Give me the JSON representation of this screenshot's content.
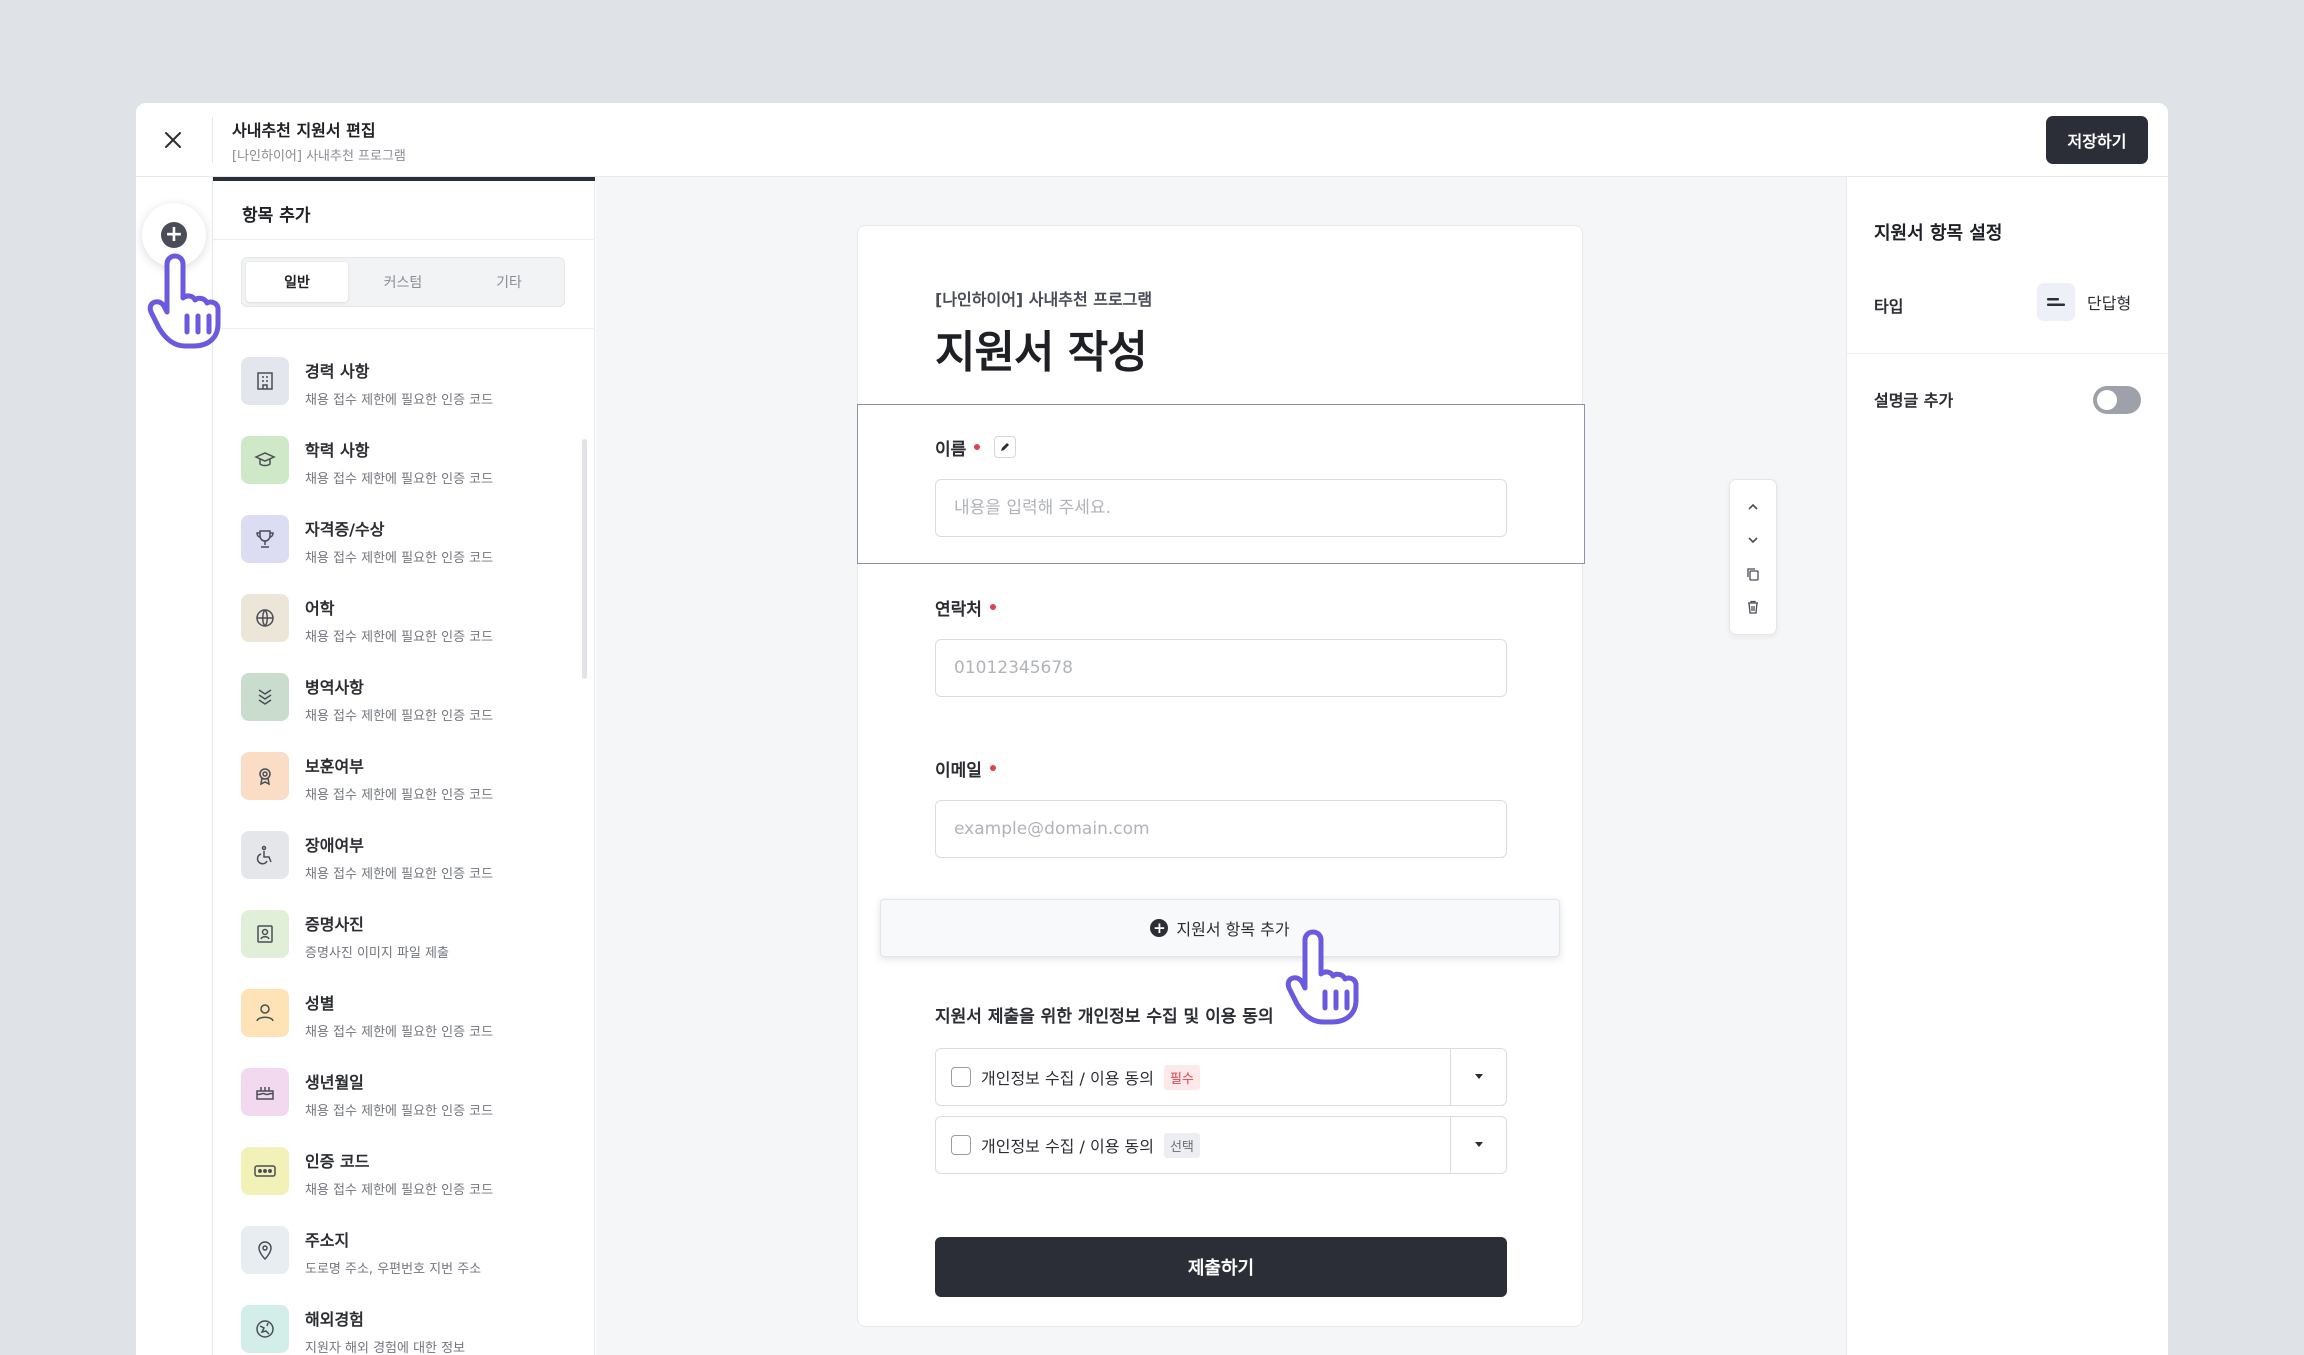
{
  "header": {
    "title": "사내추천 지원서 편집",
    "subtitle": "[나인하이어] 사내추천 프로그램",
    "save_label": "저장하기"
  },
  "panel": {
    "heading": "항목 추가",
    "tabs": [
      {
        "label": "일반",
        "active": true
      },
      {
        "label": "커스텀",
        "active": false
      },
      {
        "label": "기타",
        "active": false
      }
    ],
    "items": [
      {
        "title": "경력 사항",
        "desc": "채용 접수 제한에 필요한 인증 코드",
        "icon": "building-icon",
        "color": "#e3e6ec"
      },
      {
        "title": "학력 사항",
        "desc": "채용 접수 제한에 필요한 인증 코드",
        "icon": "graduation-cap-icon",
        "color": "#cfe9c8"
      },
      {
        "title": "자격증/수상",
        "desc": "채용 접수 제한에 필요한 인증 코드",
        "icon": "trophy-icon",
        "color": "#dcdcf3"
      },
      {
        "title": "어학",
        "desc": "채용 접수 제한에 필요한 인증 코드",
        "icon": "globe-icon",
        "color": "#ece6d8"
      },
      {
        "title": "병역사항",
        "desc": "채용 접수 제한에 필요한 인증 코드",
        "icon": "chevrons-down-icon",
        "color": "#c9dccd"
      },
      {
        "title": "보훈여부",
        "desc": "채용 접수 제한에 필요한 인증 코드",
        "icon": "medal-icon",
        "color": "#fbdcc5"
      },
      {
        "title": "장애여부",
        "desc": "채용 접수 제한에 필요한 인증 코드",
        "icon": "wheelchair-icon",
        "color": "#e4e6ea"
      },
      {
        "title": "증명사진",
        "desc": "증명사진 이미지 파일 제출",
        "icon": "id-photo-icon",
        "color": "#e1efd8"
      },
      {
        "title": "성별",
        "desc": "채용 접수 제한에 필요한 인증 코드",
        "icon": "person-icon",
        "color": "#fde3b5"
      },
      {
        "title": "생년월일",
        "desc": "채용 접수 제한에 필요한 인증 코드",
        "icon": "cake-icon",
        "color": "#f3d9ef"
      },
      {
        "title": "인증 코드",
        "desc": "채용 접수 제한에 필요한 인증 코드",
        "icon": "password-icon",
        "color": "#f1f1b8"
      },
      {
        "title": "주소지",
        "desc": "도로명 주소, 우편번호 지번 주소",
        "icon": "map-pin-icon",
        "color": "#e8edf2"
      },
      {
        "title": "해외경험",
        "desc": "지원자 해외 경험에 대한 정보",
        "icon": "globe-plane-icon",
        "color": "#d3eee8"
      }
    ]
  },
  "form": {
    "program": "[나인하이어] 사내추천 프로그램",
    "title": "지원서 작성",
    "fields": [
      {
        "label": "이름",
        "placeholder": "내용을 입력해 주세요."
      },
      {
        "label": "연락처",
        "placeholder": "01012345678"
      },
      {
        "label": "이메일",
        "placeholder": "example@domain.com"
      }
    ],
    "add_field_label": "지원서 항목 추가",
    "consent_title": "지원서 제출을 위한 개인정보 수집 및 이용 동의",
    "consents": [
      {
        "label": "개인정보 수집 / 이용 동의",
        "tag": "필수"
      },
      {
        "label": "개인정보 수집 / 이용 동의",
        "tag": "선택"
      }
    ],
    "submit_label": "제출하기"
  },
  "settings": {
    "title": "지원서 항목 설정",
    "type_label": "타입",
    "type_value": "단답형",
    "desc_label": "설명글 추가",
    "desc_enabled": false
  },
  "colors": {
    "accent": "#6a5ae0",
    "dark": "#2c2e37",
    "required": "#e0434f"
  }
}
